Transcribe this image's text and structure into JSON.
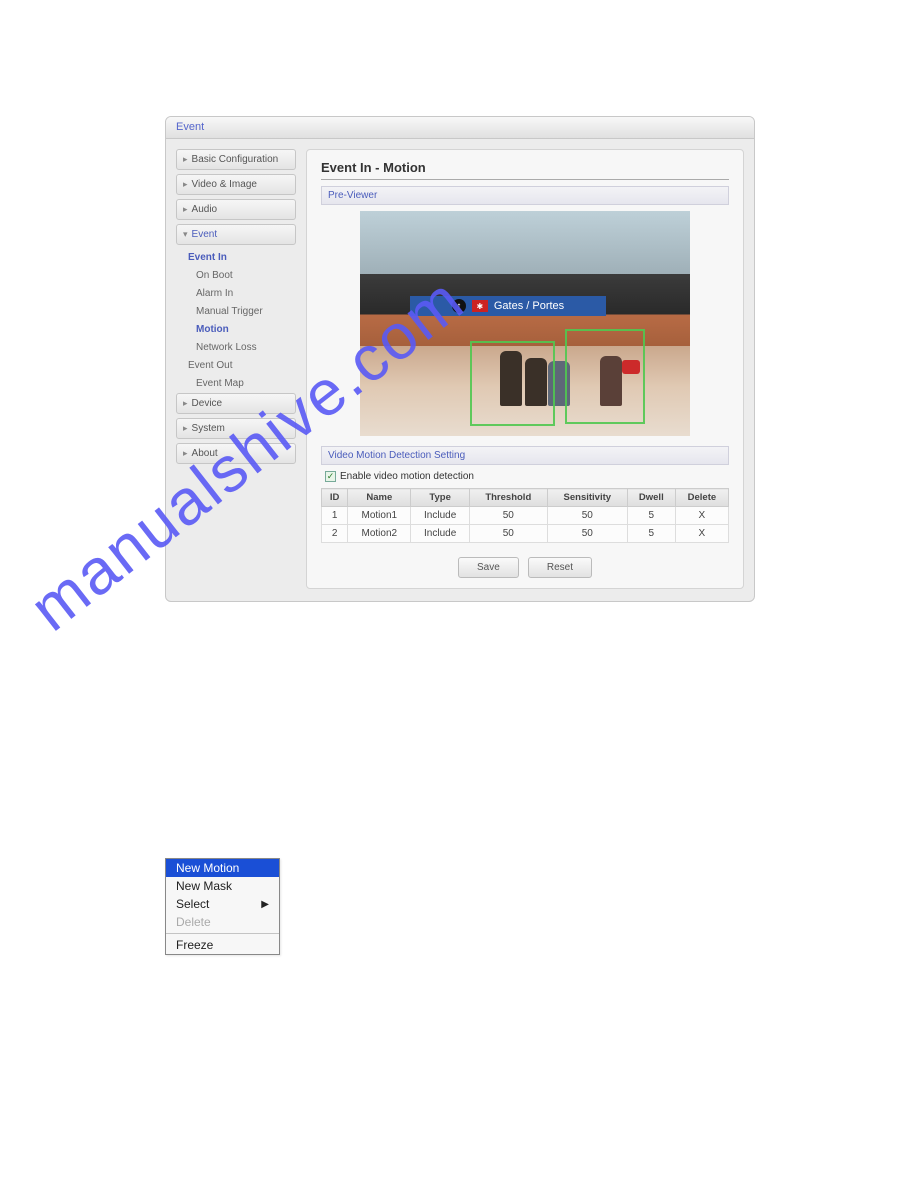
{
  "window_title": "Event",
  "nav": {
    "basic_config": "Basic Configuration",
    "video_image": "Video & Image",
    "audio": "Audio",
    "event": "Event",
    "event_in": "Event In",
    "on_boot": "On Boot",
    "alarm_in": "Alarm In",
    "manual_trigger": "Manual Trigger",
    "motion": "Motion",
    "network_loss": "Network Loss",
    "event_out": "Event Out",
    "event_map": "Event Map",
    "device": "Device",
    "system": "System",
    "about": "About"
  },
  "main": {
    "heading": "Event In - Motion",
    "preview_label": "Pre-Viewer",
    "sign_text": "Gates / Portes",
    "vmd_label": "Video Motion Detection Setting",
    "enable_label": "Enable video motion detection",
    "save": "Save",
    "reset": "Reset"
  },
  "table": {
    "headers": [
      "ID",
      "Name",
      "Type",
      "Threshold",
      "Sensitivity",
      "Dwell",
      "Delete"
    ],
    "rows": [
      {
        "id": "1",
        "name": "Motion1",
        "type": "Include",
        "threshold": "50",
        "sensitivity": "50",
        "dwell": "5",
        "delete": "X"
      },
      {
        "id": "2",
        "name": "Motion2",
        "type": "Include",
        "threshold": "50",
        "sensitivity": "50",
        "dwell": "5",
        "delete": "X"
      }
    ]
  },
  "watermark": "manualshive.com",
  "context_menu": {
    "new_motion": "New Motion",
    "new_mask": "New Mask",
    "select": "Select",
    "delete": "Delete",
    "freeze": "Freeze"
  }
}
